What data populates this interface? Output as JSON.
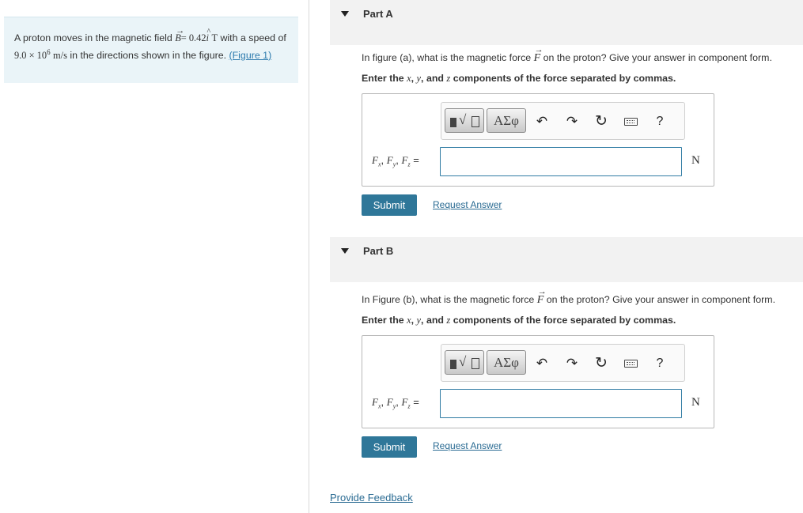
{
  "problem": {
    "text_prefix": "A proton moves in the magnetic field ",
    "field_symbol": "B",
    "field_value": "= 0.42",
    "unit_vector": "i",
    "field_unit": "T",
    "text_middle_a": " with a speed of ",
    "speed_mantissa": "9.0 × 10",
    "speed_exponent": "6",
    "speed_unit": "m/s",
    "text_suffix": " in the directions shown in the figure. ",
    "figure_link": "(Figure 1)"
  },
  "parts": [
    {
      "label": "Part A",
      "question_prefix": "In figure (a), what is the magnetic force ",
      "force_symbol": "F",
      "question_suffix": " on the proton? Give your answer in component form.",
      "instruction_prefix": "Enter the ",
      "instruction_x": "x",
      "instruction_y": "y",
      "instruction_and": "and",
      "instruction_z": "z",
      "instruction_suffix": " components of the force separated by commas.",
      "equation_label": "Fx, Fy, Fz =",
      "unit": "N",
      "input_value": "",
      "submit": "Submit",
      "request": "Request Answer"
    },
    {
      "label": "Part B",
      "question_prefix": "In Figure (b), what is the magnetic force ",
      "force_symbol": "F",
      "question_suffix": " on the proton? Give your answer in component form.",
      "instruction_prefix": "Enter the ",
      "instruction_x": "x",
      "instruction_y": "y",
      "instruction_and": "and",
      "instruction_z": "z",
      "instruction_suffix": " components of the force separated by commas.",
      "equation_label": "Fx, Fy, Fz =",
      "unit": "N",
      "input_value": "",
      "submit": "Submit",
      "request": "Request Answer"
    }
  ],
  "toolbar": {
    "greek_label": "ΑΣφ",
    "icons": [
      "templates-icon",
      "greek-symbols-icon",
      "undo-icon",
      "redo-icon",
      "reset-icon",
      "keyboard-icon",
      "help-icon"
    ],
    "help_label": "?"
  },
  "footer": {
    "feedback": "Provide Feedback"
  },
  "colors": {
    "problem_bg": "#eaf4f8",
    "part_header_bg": "#f2f2f2",
    "submit_bg": "#2f7799",
    "link": "#2a6b93",
    "input_border": "#2f7ba3"
  }
}
